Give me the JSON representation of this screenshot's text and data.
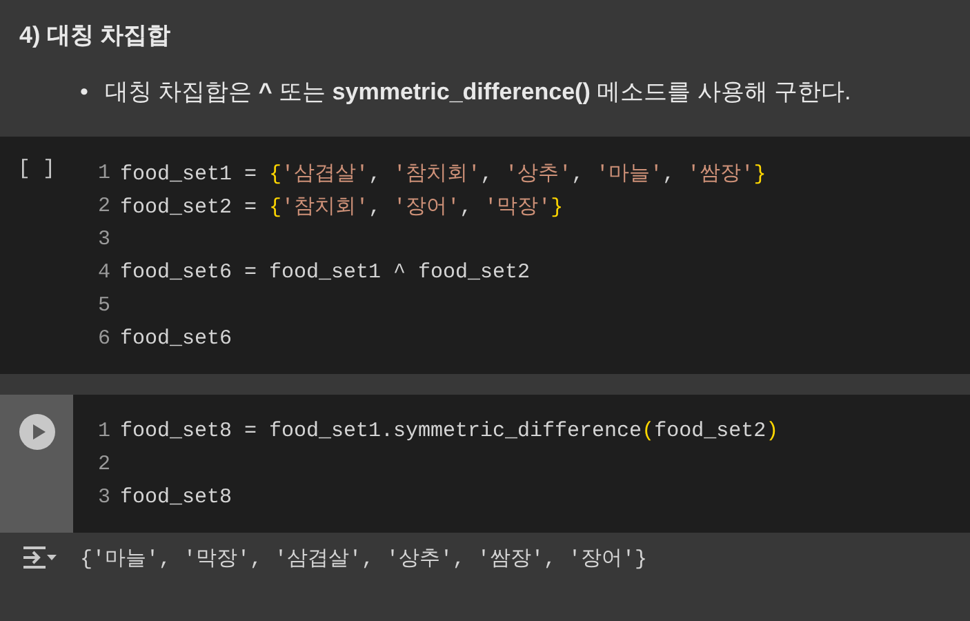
{
  "heading": "4) 대칭 차집합",
  "bullets": [
    {
      "marker": "•",
      "text": "대칭 차집합은 **^** 또는 **symmetric_difference()** 메소드를 사용해 구한다."
    }
  ],
  "cells": [
    {
      "kind": "idle",
      "prompt": "[ ]",
      "lines": [
        {
          "number": "1",
          "tokens": [
            {
              "kind": "plain",
              "text": "food_set1 = "
            },
            {
              "kind": "bracket",
              "text": "{"
            },
            {
              "kind": "string",
              "text": "'삼겹살'"
            },
            {
              "kind": "plain",
              "text": ", "
            },
            {
              "kind": "string",
              "text": "'참치회'"
            },
            {
              "kind": "plain",
              "text": ", "
            },
            {
              "kind": "string",
              "text": "'상추'"
            },
            {
              "kind": "plain",
              "text": ", "
            },
            {
              "kind": "string",
              "text": "'마늘'"
            },
            {
              "kind": "plain",
              "text": ", "
            },
            {
              "kind": "string",
              "text": "'쌈장'"
            },
            {
              "kind": "bracket",
              "text": "}"
            }
          ]
        },
        {
          "number": "2",
          "tokens": [
            {
              "kind": "plain",
              "text": "food_set2 = "
            },
            {
              "kind": "bracket",
              "text": "{"
            },
            {
              "kind": "string",
              "text": "'참치회'"
            },
            {
              "kind": "plain",
              "text": ", "
            },
            {
              "kind": "string",
              "text": "'장어'"
            },
            {
              "kind": "plain",
              "text": ", "
            },
            {
              "kind": "string",
              "text": "'막장'"
            },
            {
              "kind": "bracket",
              "text": "}"
            }
          ]
        },
        {
          "number": "3"
        },
        {
          "number": "4",
          "tokens": [
            {
              "kind": "plain",
              "text": "food_set6 = food_set1 ^ food_set2"
            }
          ]
        },
        {
          "number": "5"
        },
        {
          "number": "6",
          "tokens": [
            {
              "kind": "plain",
              "text": "food_set6"
            }
          ]
        }
      ]
    },
    {
      "kind": "run",
      "lines": [
        {
          "number": "1",
          "tokens": [
            {
              "kind": "plain",
              "text": "food_set8 = food_set1.symmetric_difference"
            },
            {
              "kind": "bracket",
              "text": "("
            },
            {
              "kind": "plain",
              "text": "food_set2"
            },
            {
              "kind": "bracket",
              "text": ")"
            }
          ]
        },
        {
          "number": "2"
        },
        {
          "number": "3",
          "tokens": [
            {
              "kind": "plain",
              "text": "food_set8"
            }
          ]
        }
      ],
      "output": "{'마늘', '막장', '삼겹살', '상추', '쌈장', '장어'}"
    }
  ]
}
